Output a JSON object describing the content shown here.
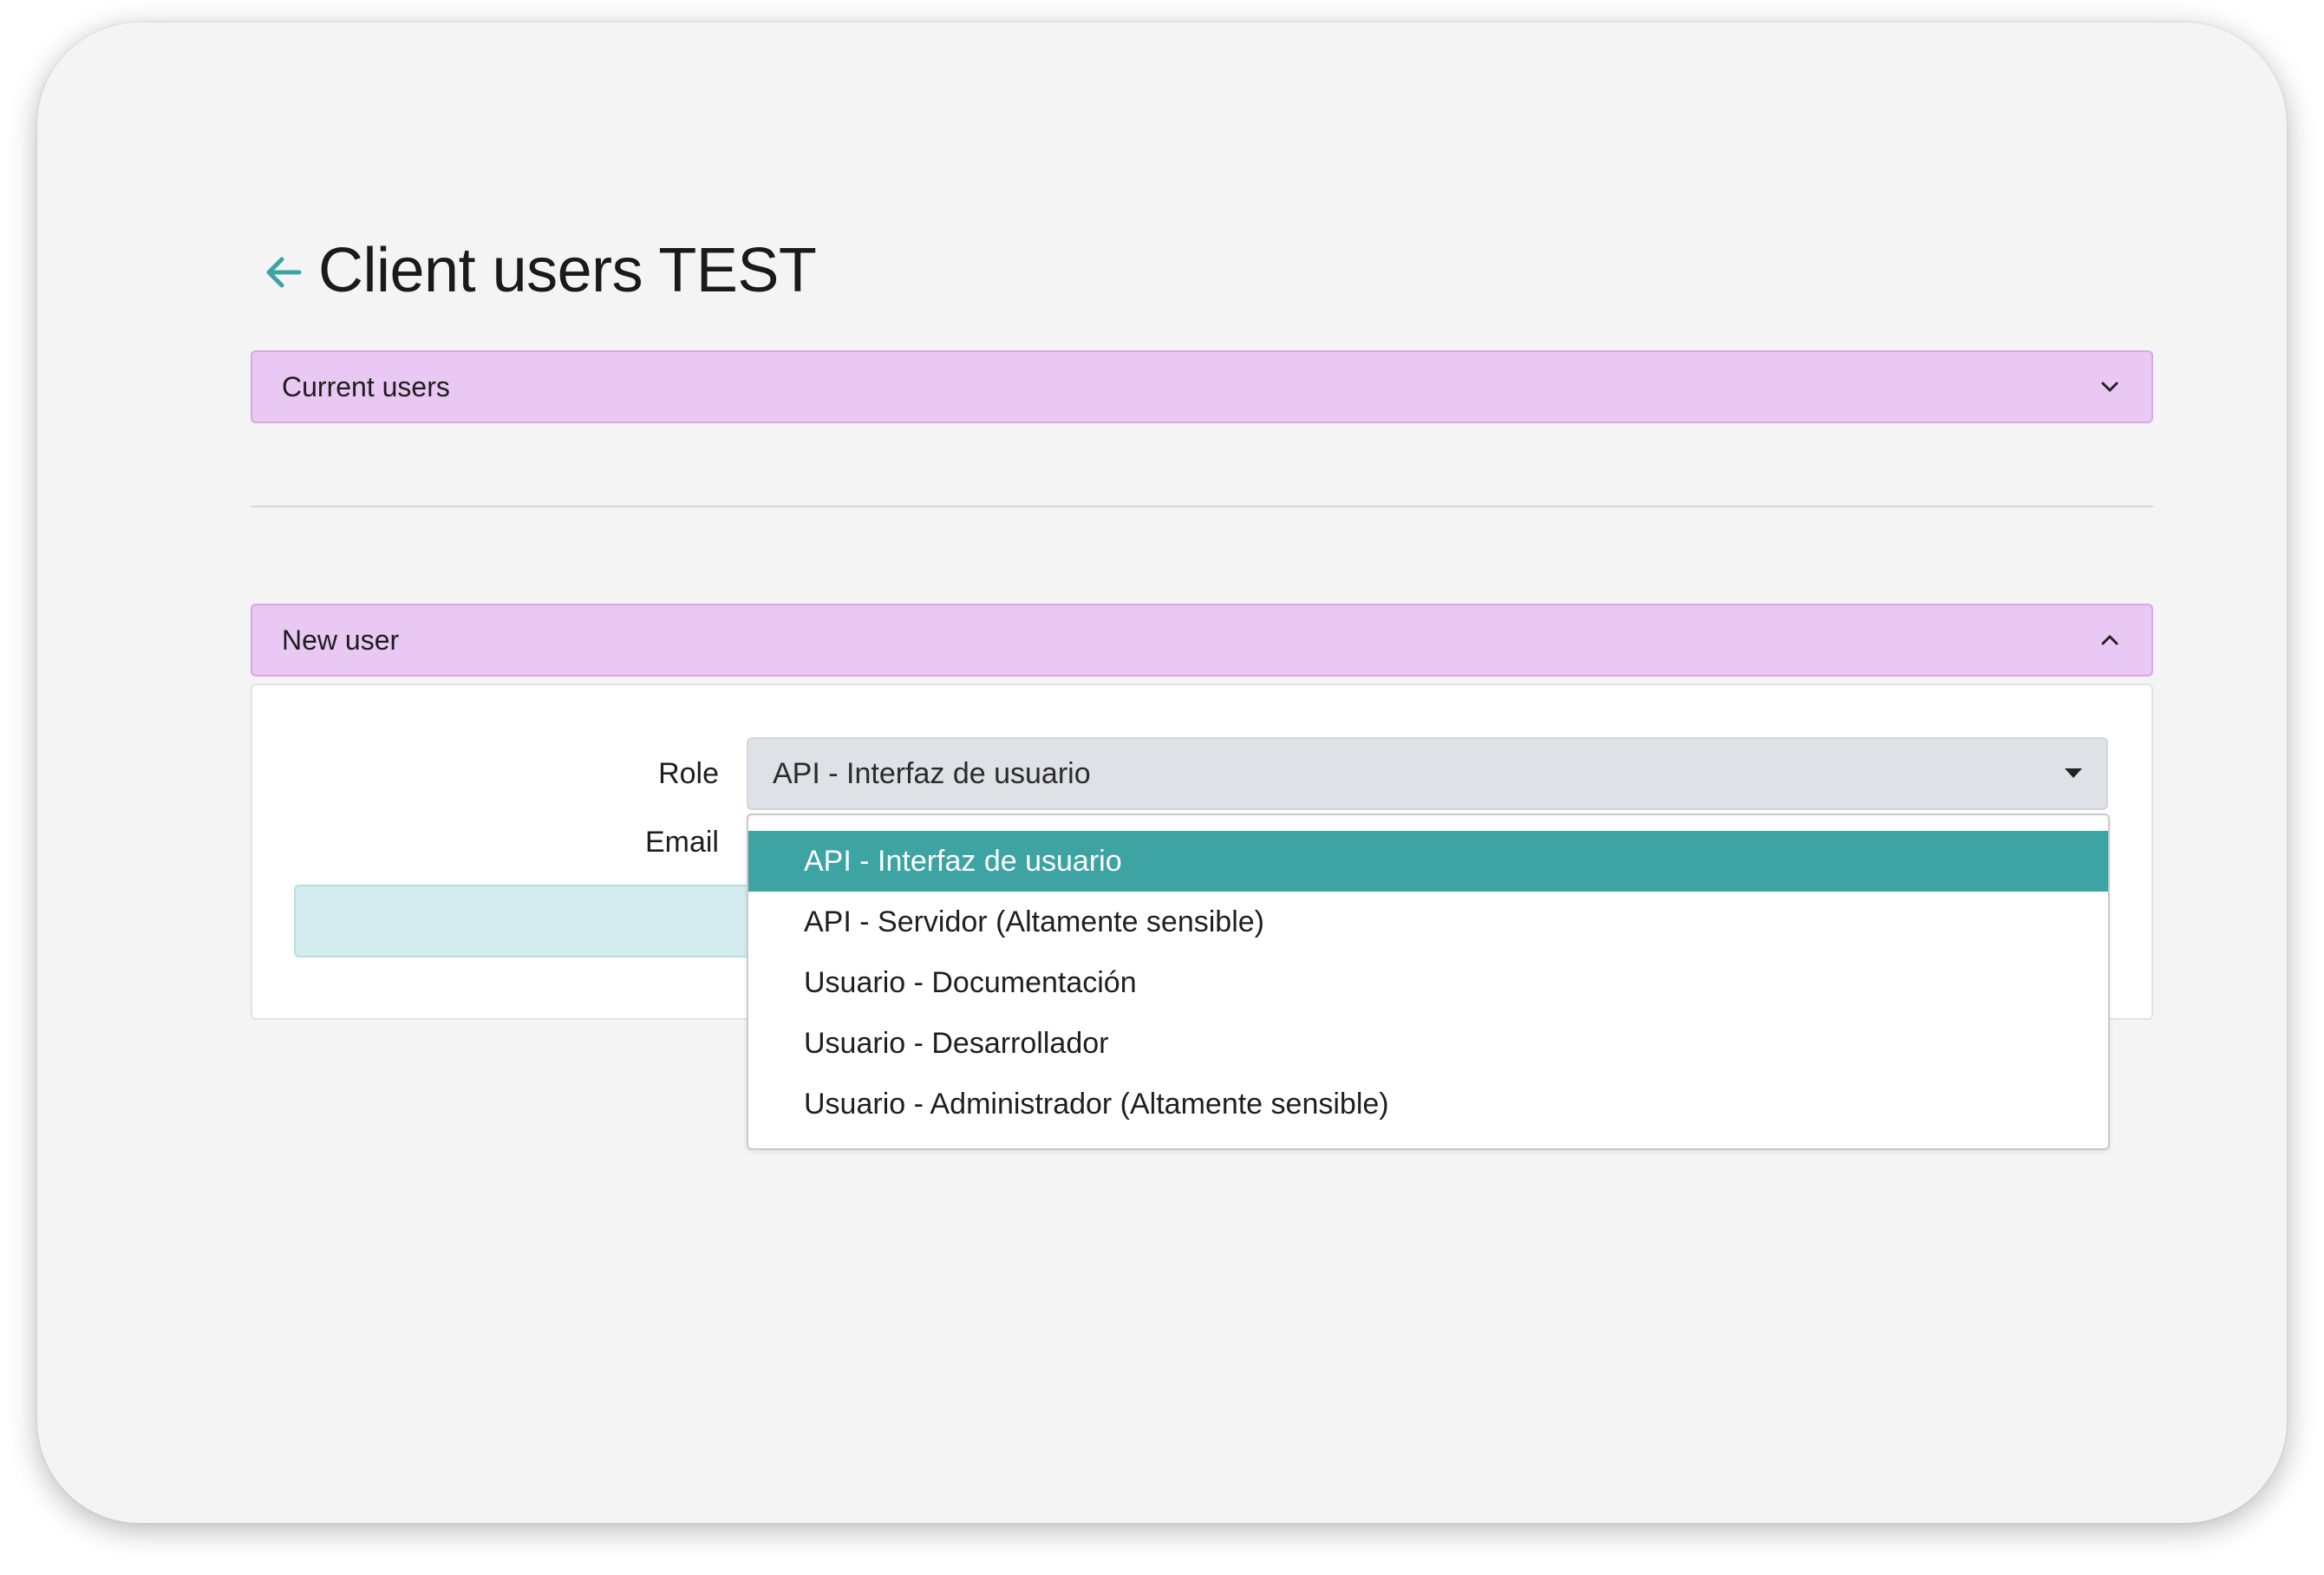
{
  "header": {
    "back_icon": "arrow-left-icon",
    "title": "Client users TEST"
  },
  "colors": {
    "accent": "#3ea3a3",
    "accordion_bg": "#e9c8f3",
    "submit_bg": "#d4ecee"
  },
  "sections": {
    "current_users": {
      "title": "Current users",
      "state": "collapsed",
      "icon": "chevron-down-icon"
    },
    "new_user": {
      "title": "New user",
      "state": "expanded",
      "icon": "chevron-up-icon"
    }
  },
  "form": {
    "role_label": "Role",
    "role_value": "API - Interfaz de usuario",
    "email_label": "Email",
    "role_options": [
      {
        "label": "API - Interfaz de usuario",
        "selected": true
      },
      {
        "label": "API - Servidor (Altamente sensible)",
        "selected": false
      },
      {
        "label": "Usuario - Documentación",
        "selected": false
      },
      {
        "label": "Usuario - Desarrollador",
        "selected": false
      },
      {
        "label": "Usuario - Administrador (Altamente sensible)",
        "selected": false
      }
    ]
  }
}
